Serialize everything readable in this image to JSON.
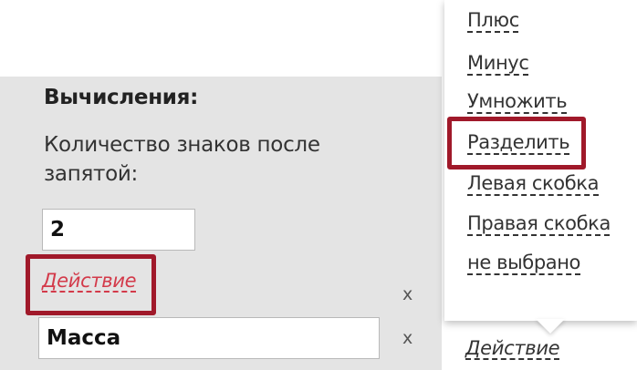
{
  "calc": {
    "title": "Вычисления:",
    "decimals_label": "Количество знаков после запятой:",
    "decimals_value": "2",
    "action_link": "Действие",
    "remove_symbol": "x",
    "field_value": "Масса"
  },
  "dropdown": {
    "items": [
      "Плюс",
      "Минус",
      "Умножить",
      "Разделить",
      "Левая скобка",
      "Правая скобка",
      "не выбрано"
    ],
    "highlighted_item": "Разделить",
    "trigger_label": "Действие"
  },
  "colors": {
    "panel_bg": "#e4e4e4",
    "highlight_border": "#a0192a",
    "action_link": "#d33a4a"
  }
}
